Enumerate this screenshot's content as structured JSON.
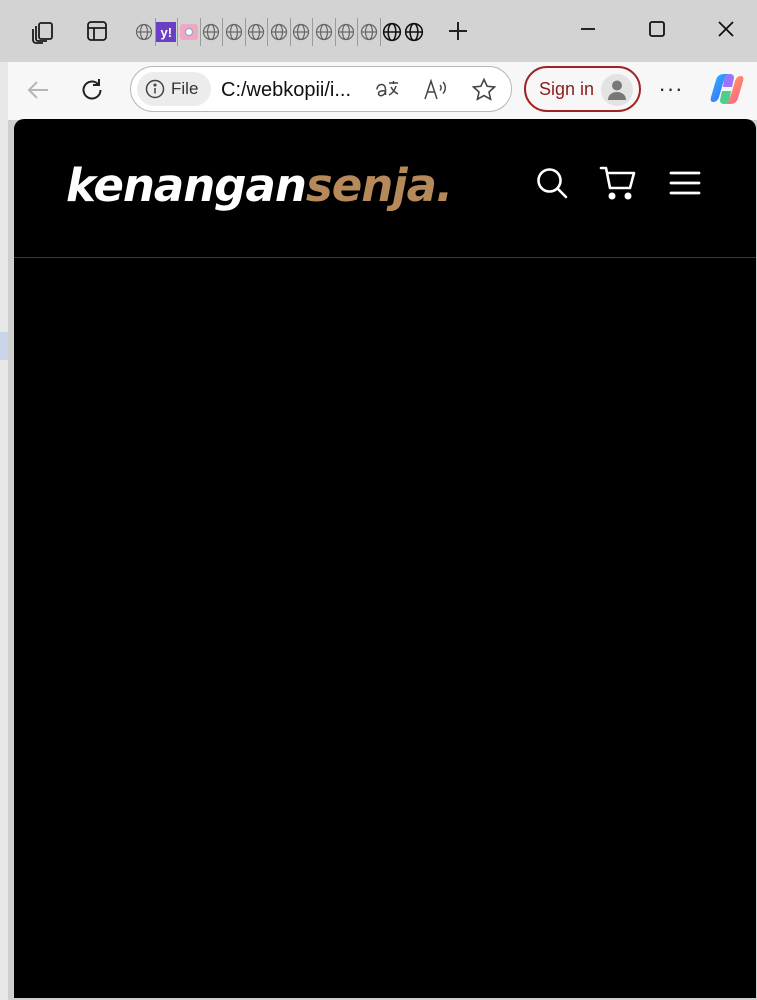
{
  "browser": {
    "address_bar": {
      "scheme_label": "File",
      "url": "C:/webkopii/i..."
    },
    "sign_in_label": "Sign in",
    "more_label": "···",
    "icons": {
      "workspaces": "workspaces-icon",
      "vertical_tabs": "vertical-tabs-icon",
      "new_tab": "plus-icon",
      "minimize": "minimize-icon",
      "maximize": "maximize-icon",
      "close": "close-icon",
      "back": "back-arrow-icon",
      "refresh": "refresh-icon",
      "info": "info-icon",
      "translate": "translate-icon",
      "read_aloud": "read-aloud-icon",
      "favorite": "star-icon",
      "profile": "profile-icon",
      "copilot": "copilot-icon"
    }
  },
  "site": {
    "logo": {
      "part1": "kenangan",
      "part2": "senja",
      "dot": "."
    },
    "header_icons": [
      "search-icon",
      "cart-icon",
      "hamburger-menu-icon"
    ],
    "colors": {
      "background": "#000000",
      "logo_primary": "#ffffff",
      "logo_accent": "#b6895b"
    }
  }
}
